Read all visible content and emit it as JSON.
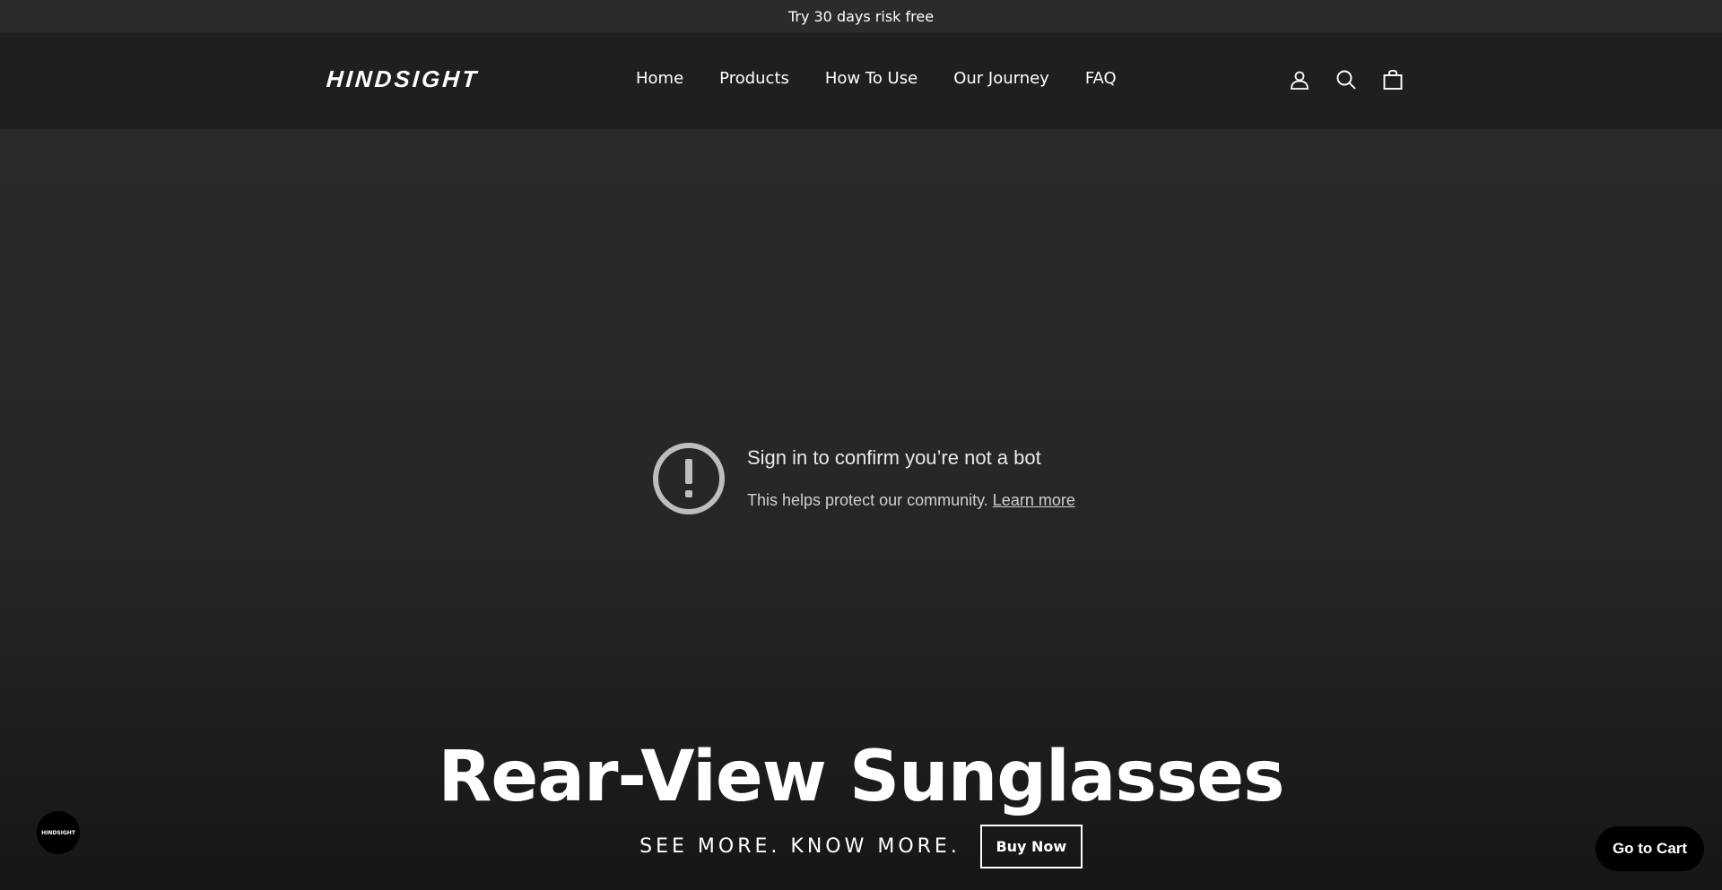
{
  "announcement": {
    "text": "Try 30 days risk free"
  },
  "header": {
    "logo": "HINDSIGHT",
    "nav": [
      {
        "label": "Home"
      },
      {
        "label": "Products"
      },
      {
        "label": "How To Use"
      },
      {
        "label": "Our Journey"
      },
      {
        "label": "FAQ"
      }
    ],
    "icons": [
      "account-icon",
      "search-icon",
      "cart-icon"
    ]
  },
  "video_notice": {
    "icon": "exclamation-circle-icon",
    "title": "Sign in to confirm you’re not a bot",
    "text": "This helps protect our community.",
    "link": "Learn more"
  },
  "hero": {
    "title": "Rear-View Sunglasses",
    "tagline": "SEE MORE. KNOW MORE.",
    "button": "Buy Now"
  },
  "chat_badge": {
    "label": "HINDSIGHT"
  },
  "cart_button": {
    "label": "Go to Cart"
  },
  "colors": {
    "background": "#262626",
    "header": "#1f1f1f",
    "announcement_bar": "#2b2b2b",
    "text": "#ffffff",
    "notice_icon": "#bdbdbd"
  }
}
